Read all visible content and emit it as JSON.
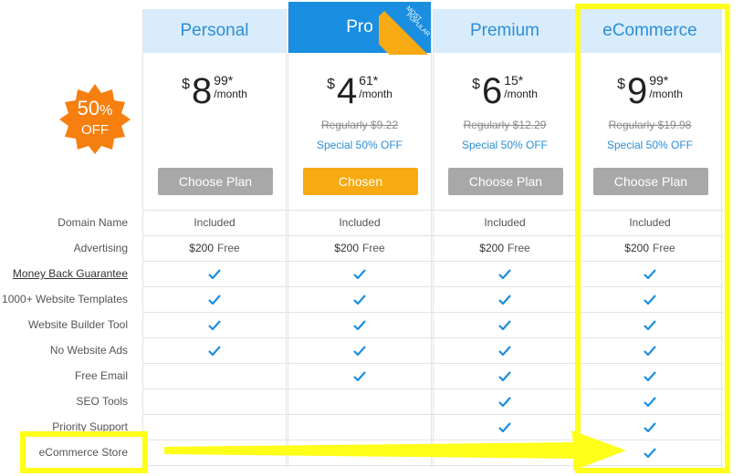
{
  "badge": {
    "percent": "50",
    "pct_sign": "%",
    "off": "OFF"
  },
  "ribbon": {
    "line1": "MOST",
    "line2": "POPULAR"
  },
  "plans": [
    {
      "name": "Personal",
      "currency": "$",
      "dollars": "8",
      "cents": "99*",
      "period": "/month",
      "regular": "",
      "special": "",
      "button": "Choose Plan"
    },
    {
      "name": "Pro",
      "currency": "$",
      "dollars": "4",
      "cents": "61*",
      "period": "/month",
      "regular": "Regularly $9.22",
      "special": "Special 50% OFF",
      "button": "Chosen"
    },
    {
      "name": "Premium",
      "currency": "$",
      "dollars": "6",
      "cents": "15*",
      "period": "/month",
      "regular": "Regularly $12.29",
      "special": "Special 50% OFF",
      "button": "Choose Plan"
    },
    {
      "name": "eCommerce",
      "currency": "$",
      "dollars": "9",
      "cents": "99*",
      "period": "/month",
      "regular": "Regularly $19.98",
      "special": "Special 50% OFF",
      "button": "Choose Plan"
    }
  ],
  "features": [
    {
      "label": "Domain Name",
      "values": [
        "Included",
        "Included",
        "Included",
        "Included"
      ]
    },
    {
      "label": "Advertising",
      "values": [
        "$200|Free",
        "$200|Free",
        "$200|Free",
        "$200|Free"
      ]
    },
    {
      "label": "Money Back Guarantee",
      "values": [
        "check",
        "check",
        "check",
        "check"
      ]
    },
    {
      "label": "1000+ Website Templates",
      "values": [
        "check",
        "check",
        "check",
        "check"
      ]
    },
    {
      "label": "Website Builder Tool",
      "values": [
        "check",
        "check",
        "check",
        "check"
      ]
    },
    {
      "label": "No Website Ads",
      "values": [
        "check",
        "check",
        "check",
        "check"
      ]
    },
    {
      "label": "Free Email",
      "values": [
        "",
        "check",
        "check",
        "check"
      ]
    },
    {
      "label": "SEO Tools",
      "values": [
        "",
        "",
        "check",
        "check"
      ]
    },
    {
      "label": "Priority Support",
      "values": [
        "",
        "",
        "check",
        "check"
      ]
    },
    {
      "label": "eCommerce Store",
      "values": [
        "",
        "",
        "",
        "check"
      ]
    }
  ],
  "colors": {
    "accent_blue": "#1a8ee0",
    "header_light": "#d9ecfb",
    "chosen": "#f7aa12",
    "button_grey": "#a8a8a8",
    "badge_orange": "#f77f0f",
    "highlight_yellow": "#ffff1a"
  }
}
